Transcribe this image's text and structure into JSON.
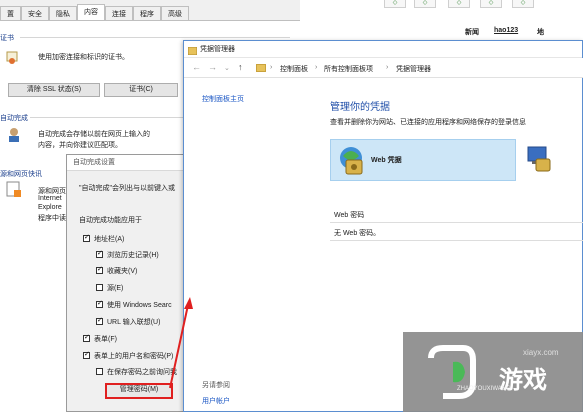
{
  "internet_options": {
    "tabs": [
      "置",
      "安全",
      "隐私",
      "内容",
      "连接",
      "程序",
      "高级"
    ],
    "active_tab_index": 3,
    "cert_section": "证书",
    "cert_desc": "使用加密连接和标识的证书。",
    "clear_ssl_button": "清除 SSL 状态(S)",
    "certificates_button": "证书(C)",
    "autocomplete_section": "自动完成",
    "autocomplete_desc_1": "自动完成会存储以前在网页上输入的",
    "autocomplete_desc_2": "内容，并向你建议匹配项。",
    "feeds_section": "源和网页快讯",
    "feeds_desc_1": "源和网页快",
    "feeds_desc_2": "Internet",
    "feeds_desc_3": "Explore",
    "feeds_desc_4": "程序中读"
  },
  "autocomplete_dialog": {
    "title": "自动完成设置",
    "intro": "\"自动完成\"会列出与以前键入或",
    "group_label": "自动完成功能应用于",
    "options": [
      {
        "label": "地址栏(A)",
        "checked": true
      },
      {
        "label": "浏览历史记录(H)",
        "checked": true
      },
      {
        "label": "收藏夹(V)",
        "checked": true
      },
      {
        "label": "源(E)",
        "checked": false
      },
      {
        "label": "使用 Windows Searc",
        "checked": true
      },
      {
        "label": "URL 输入联想(U)",
        "checked": true
      },
      {
        "label": "表单(F)",
        "checked": true
      },
      {
        "label": "表单上的用户名和密码(P)",
        "checked": true
      },
      {
        "label": "在保存密码之前询问我",
        "checked": false
      }
    ],
    "manage_passwords_button": "管理密码(M)"
  },
  "credential_manager": {
    "title": "凭据管理器",
    "breadcrumb": [
      "控制面板",
      "所有控制面板项",
      "凭据管理器"
    ],
    "home_link": "控制面板主页",
    "heading": "管理你的凭据",
    "description": "查看并删除你为网站、已连接的应用程序和网络保存的登录信息",
    "web_credentials_label": "Web 凭据",
    "web_passwords_header": "Web 密码",
    "no_passwords": "无 Web 密码。",
    "see_also": "另请参阅",
    "user_accounts": "用户帐户"
  },
  "browser_strip": {
    "links": [
      "新闻",
      "hao123",
      "地"
    ]
  },
  "watermark": {
    "brand_cn": "游戏",
    "domain": "xiayx.com",
    "site_name": "ZHAOYOUXIWANG"
  },
  "colors": {
    "arrow": "#e02020",
    "link": "#1a56c4",
    "selected_tile": "#cde6f7"
  }
}
